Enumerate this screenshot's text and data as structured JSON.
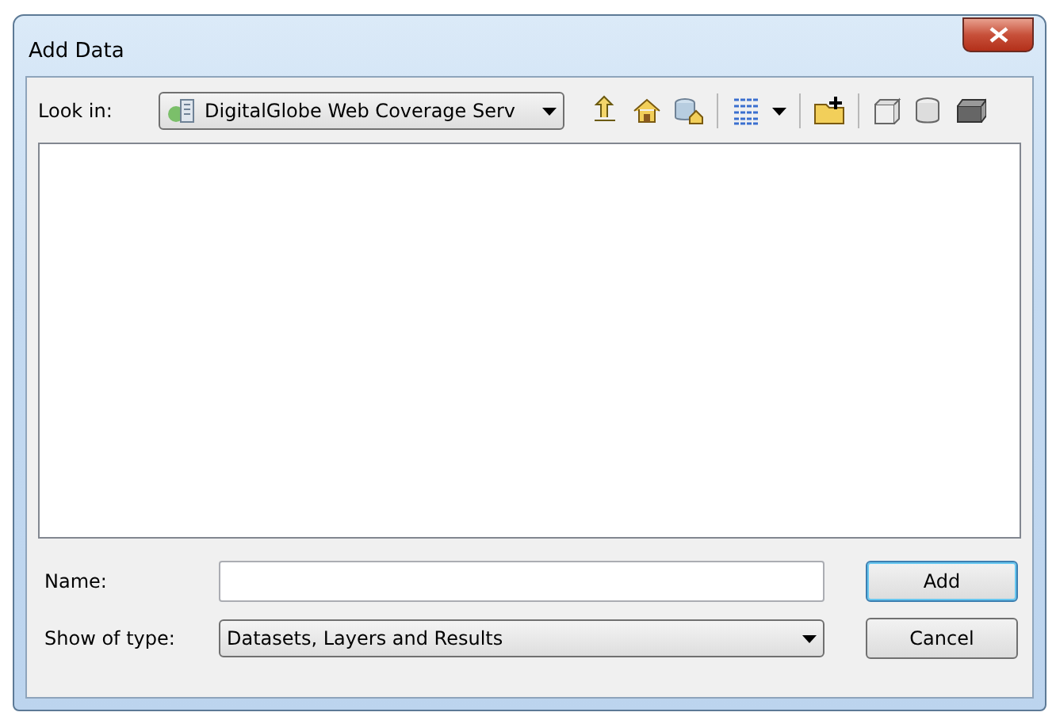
{
  "window": {
    "title": "Add Data"
  },
  "look_in": {
    "label": "Look in:",
    "value": "DigitalGlobe Web Coverage Serv"
  },
  "name_field": {
    "label": "Name:"
  },
  "type_field": {
    "label": "Show of type:",
    "value": "Datasets, Layers and Results"
  },
  "buttons": [
    {
      "label": "Add",
      "focused": true
    },
    {
      "label": "Cancel",
      "focused": false
    }
  ]
}
